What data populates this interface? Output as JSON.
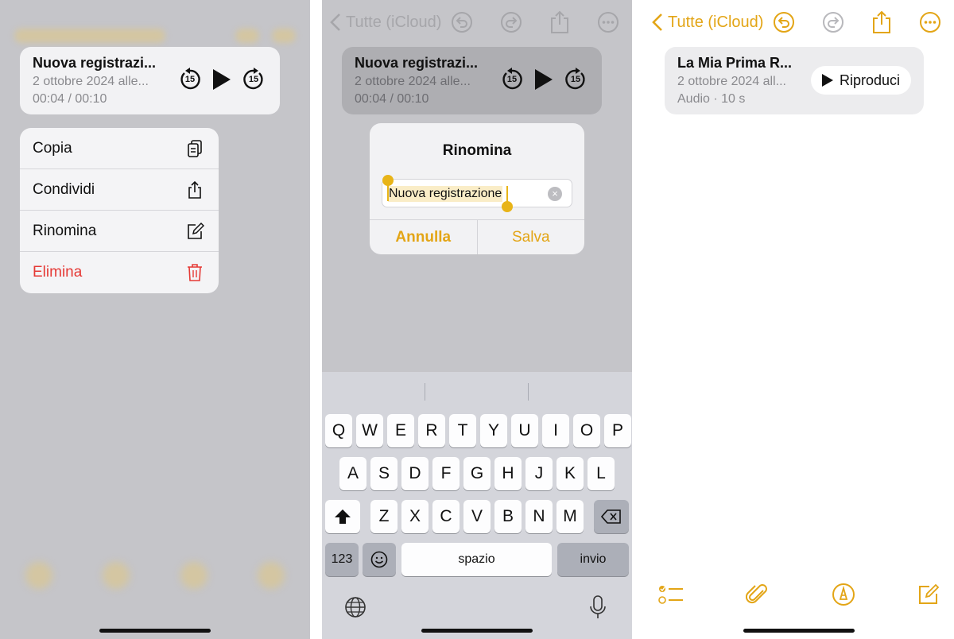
{
  "colors": {
    "accent": "#e3a516",
    "danger": "#e53935",
    "dim_overlay": "#c5c5c9",
    "keyboard": "#d4d5db"
  },
  "screen1": {
    "audio": {
      "title": "Nuova registrazi...",
      "subtitle": "2 ottobre 2024 alle...",
      "time": "00:04 / 00:10",
      "skip_back": "15",
      "skip_forward": "15"
    },
    "menu": [
      {
        "label": "Copia",
        "icon": "copy-icon"
      },
      {
        "label": "Condividi",
        "icon": "share-icon"
      },
      {
        "label": "Rinomina",
        "icon": "compose-icon"
      },
      {
        "label": "Elimina",
        "icon": "trash-icon"
      }
    ]
  },
  "screen2": {
    "nav": {
      "back_label": "Tutte (iCloud)"
    },
    "audio": {
      "title": "Nuova registrazi...",
      "subtitle": "2 ottobre 2024 alle...",
      "time": "00:04 / 00:10",
      "skip_back": "15",
      "skip_forward": "15"
    },
    "dialog": {
      "title": "Rinomina",
      "input_value": "Nuova registrazione",
      "cancel_label": "Annulla",
      "save_label": "Salva"
    },
    "keyboard": {
      "row1": [
        "Q",
        "W",
        "E",
        "R",
        "T",
        "Y",
        "U",
        "I",
        "O",
        "P"
      ],
      "row2": [
        "A",
        "S",
        "D",
        "F",
        "G",
        "H",
        "J",
        "K",
        "L"
      ],
      "row3": [
        "Z",
        "X",
        "C",
        "V",
        "B",
        "N",
        "M"
      ],
      "numbers_label": "123",
      "space_label": "spazio",
      "return_label": "invio"
    }
  },
  "screen3": {
    "nav": {
      "back_label": "Tutte (iCloud)"
    },
    "note": {
      "title": "La Mia Prima R...",
      "subtitle": "2 ottobre 2024 all...",
      "meta": "Audio · 10 s",
      "play_label": "Riproduci"
    }
  }
}
